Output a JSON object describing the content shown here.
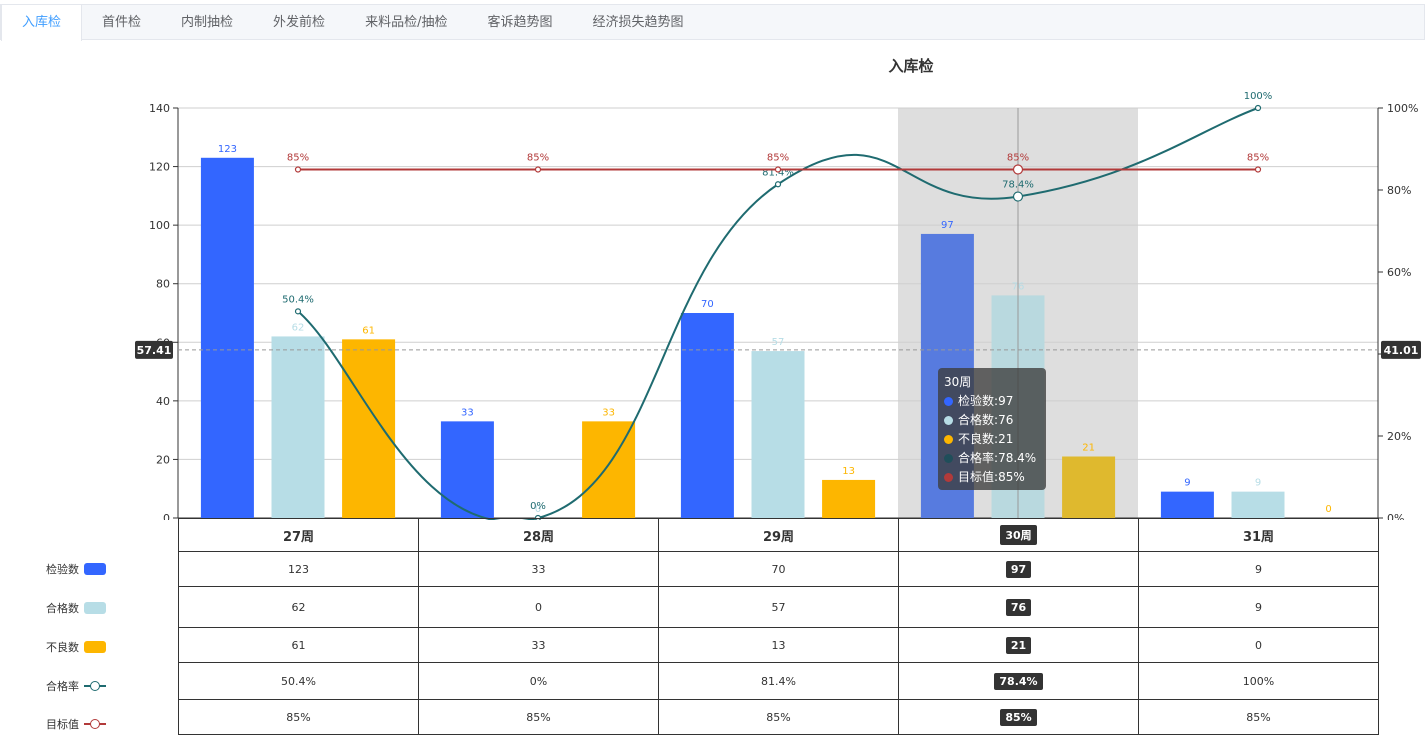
{
  "tabs": [
    {
      "label": "入库检",
      "active": true
    },
    {
      "label": "首件检",
      "active": false
    },
    {
      "label": "内制抽检",
      "active": false
    },
    {
      "label": "外发前检",
      "active": false
    },
    {
      "label": "来料品检/抽检",
      "active": false
    },
    {
      "label": "客诉趋势图",
      "active": false
    },
    {
      "label": "经济损失趋势图",
      "active": false
    }
  ],
  "chart_data": {
    "type": "bar",
    "title": "入库检",
    "categories": [
      "27周",
      "28周",
      "29周",
      "30周",
      "31周"
    ],
    "ylim": [
      0,
      140
    ],
    "y_ticks": [
      "0",
      "20",
      "40",
      "60",
      "80",
      "100",
      "120",
      "140"
    ],
    "y2lim": [
      0,
      100
    ],
    "y2_ticks": [
      "0%",
      "20%",
      "40%",
      "60%",
      "80%",
      "100%"
    ],
    "grid": true,
    "bar_series": [
      {
        "name": "检验数",
        "color": "#3366ff",
        "values": [
          123,
          33,
          70,
          97,
          9
        ]
      },
      {
        "name": "合格数",
        "color": "#b7dde6",
        "values": [
          62,
          0,
          57,
          76,
          9
        ]
      },
      {
        "name": "不良数",
        "color": "#fdb600",
        "values": [
          61,
          33,
          13,
          21,
          0
        ]
      }
    ],
    "line_series": [
      {
        "name": "合格率",
        "color": "#1f6b70",
        "values": [
          50.4,
          0,
          81.4,
          78.4,
          100
        ],
        "labels": [
          "50.4%",
          "0%",
          "81.4%",
          "78.4%",
          "100%"
        ],
        "axis": "right",
        "smooth": true
      },
      {
        "name": "目标值",
        "color": "#b23a3a",
        "values": [
          85,
          85,
          85,
          85,
          85
        ],
        "labels": [
          "85%",
          "85%",
          "85%",
          "85%",
          "85%"
        ],
        "axis": "right",
        "smooth": false
      }
    ],
    "highlight_index": 3,
    "crosshair": {
      "left_label": "57.41",
      "right_label": "41.01",
      "left_value": 57.41
    }
  },
  "tooltip": {
    "title": "30周",
    "rows": [
      {
        "name": "检验数",
        "value": "97",
        "color": "#3366ff"
      },
      {
        "name": "合格数",
        "value": "76",
        "color": "#b7dde6"
      },
      {
        "name": "不良数",
        "value": "21",
        "color": "#fdb600"
      },
      {
        "name": "合格率",
        "value": "78.4%",
        "color": "#1f4e5a"
      },
      {
        "name": "目标值",
        "value": "85%",
        "color": "#b23a3a"
      }
    ]
  },
  "legend": [
    {
      "label": "检验数",
      "kind": "bar",
      "color": "#3366ff"
    },
    {
      "label": "合格数",
      "kind": "bar",
      "color": "#b7dde6"
    },
    {
      "label": "不良数",
      "kind": "bar",
      "color": "#fdb600"
    },
    {
      "label": "合格率",
      "kind": "line",
      "color": "#1f6b70"
    },
    {
      "label": "目标值",
      "kind": "line",
      "color": "#b23a3a"
    }
  ],
  "table": {
    "header": [
      "27周",
      "28周",
      "29周",
      "30周",
      "31周"
    ],
    "rows": [
      [
        "123",
        "33",
        "70",
        "97",
        "9"
      ],
      [
        "62",
        "0",
        "57",
        "76",
        "9"
      ],
      [
        "61",
        "33",
        "13",
        "21",
        "0"
      ],
      [
        "50.4%",
        "0%",
        "81.4%",
        "78.4%",
        "100%"
      ],
      [
        "85%",
        "85%",
        "85%",
        "85%",
        "85%"
      ]
    ],
    "highlight_col": 3
  }
}
